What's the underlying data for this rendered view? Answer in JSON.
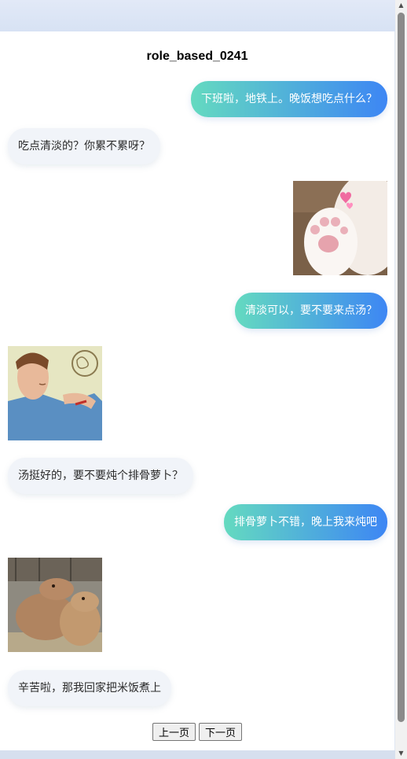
{
  "page": {
    "title": "role_based_0241"
  },
  "messages": [
    {
      "role": "user",
      "type": "text",
      "text": "下班啦，地铁上。晚饭想吃点什么？"
    },
    {
      "role": "bot",
      "type": "text",
      "text": "吃点清淡的？你累不累呀？"
    },
    {
      "role": "user",
      "type": "image",
      "alt": "cat-paw-sticker"
    },
    {
      "role": "user",
      "type": "text",
      "text": "清淡可以，要不要来点汤？"
    },
    {
      "role": "bot",
      "type": "image",
      "alt": "thinking-man-sticker"
    },
    {
      "role": "bot",
      "type": "text",
      "text": "汤挺好的，要不要炖个排骨萝卜？"
    },
    {
      "role": "user",
      "type": "text",
      "text": "排骨萝卜不错，晚上我来炖吧"
    },
    {
      "role": "bot",
      "type": "image",
      "alt": "capybara-hug-sticker"
    },
    {
      "role": "bot",
      "type": "text",
      "text": "辛苦啦，那我回家把米饭煮上"
    }
  ],
  "pager": {
    "prev_label": "上一页",
    "next_label": "下一页"
  },
  "colors": {
    "user_gradient_start": "#64dac0",
    "user_gradient_end": "#3d86f4",
    "bot_bubble": "#f1f4f9",
    "background": "#dfe7f3"
  },
  "icons": {
    "scroll_up": "triangle-up",
    "scroll_down": "triangle-down"
  }
}
